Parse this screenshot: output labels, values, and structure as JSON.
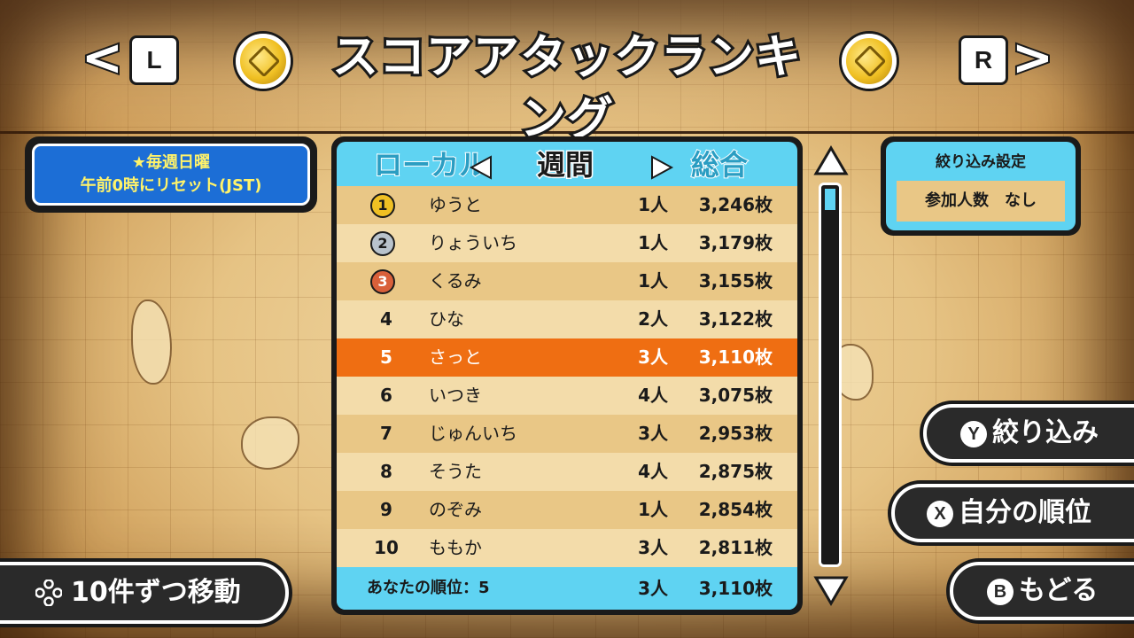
{
  "header": {
    "title": "スコアアタックランキング",
    "left_button": "L",
    "right_button": "R"
  },
  "info": {
    "line1": "★毎週日曜",
    "line2": "午前0時にリセット(JST)"
  },
  "tabs": {
    "left": "ローカル",
    "center": "週間",
    "right": "総合"
  },
  "rankings": [
    {
      "rank": "1",
      "medal": "gold",
      "name": "ゆうと",
      "people": "1人",
      "score": "3,246枚"
    },
    {
      "rank": "2",
      "medal": "silver",
      "name": "りょういち",
      "people": "1人",
      "score": "3,179枚"
    },
    {
      "rank": "3",
      "medal": "bronze",
      "name": "くるみ",
      "people": "1人",
      "score": "3,155枚"
    },
    {
      "rank": "4",
      "name": "ひな",
      "people": "2人",
      "score": "3,122枚"
    },
    {
      "rank": "5",
      "name": "さっと",
      "people": "3人",
      "score": "3,110枚",
      "highlight": true
    },
    {
      "rank": "6",
      "name": "いつき",
      "people": "4人",
      "score": "3,075枚"
    },
    {
      "rank": "7",
      "name": "じゅんいち",
      "people": "3人",
      "score": "2,953枚"
    },
    {
      "rank": "8",
      "name": "そうた",
      "people": "4人",
      "score": "2,875枚"
    },
    {
      "rank": "9",
      "name": "のぞみ",
      "people": "1人",
      "score": "2,854枚"
    },
    {
      "rank": "10",
      "name": "ももか",
      "people": "3人",
      "score": "2,811枚"
    }
  ],
  "my_rank": {
    "label": "あなたの順位：5",
    "people": "3人",
    "score": "3,110枚"
  },
  "filter": {
    "title": "絞り込み設定",
    "value": "参加人数　なし"
  },
  "buttons": {
    "filter": {
      "glyph": "Y",
      "label": "絞り込み"
    },
    "my_rank": {
      "glyph": "X",
      "label": "自分の順位"
    },
    "back": {
      "glyph": "B",
      "label": "もどる"
    },
    "page": {
      "label": "10件ずつ移動"
    }
  },
  "colors": {
    "panel": "#5fd3f2",
    "highlight": "#ef6e12",
    "row_odd": "#e9c786",
    "row_even": "#f3dcaa"
  }
}
